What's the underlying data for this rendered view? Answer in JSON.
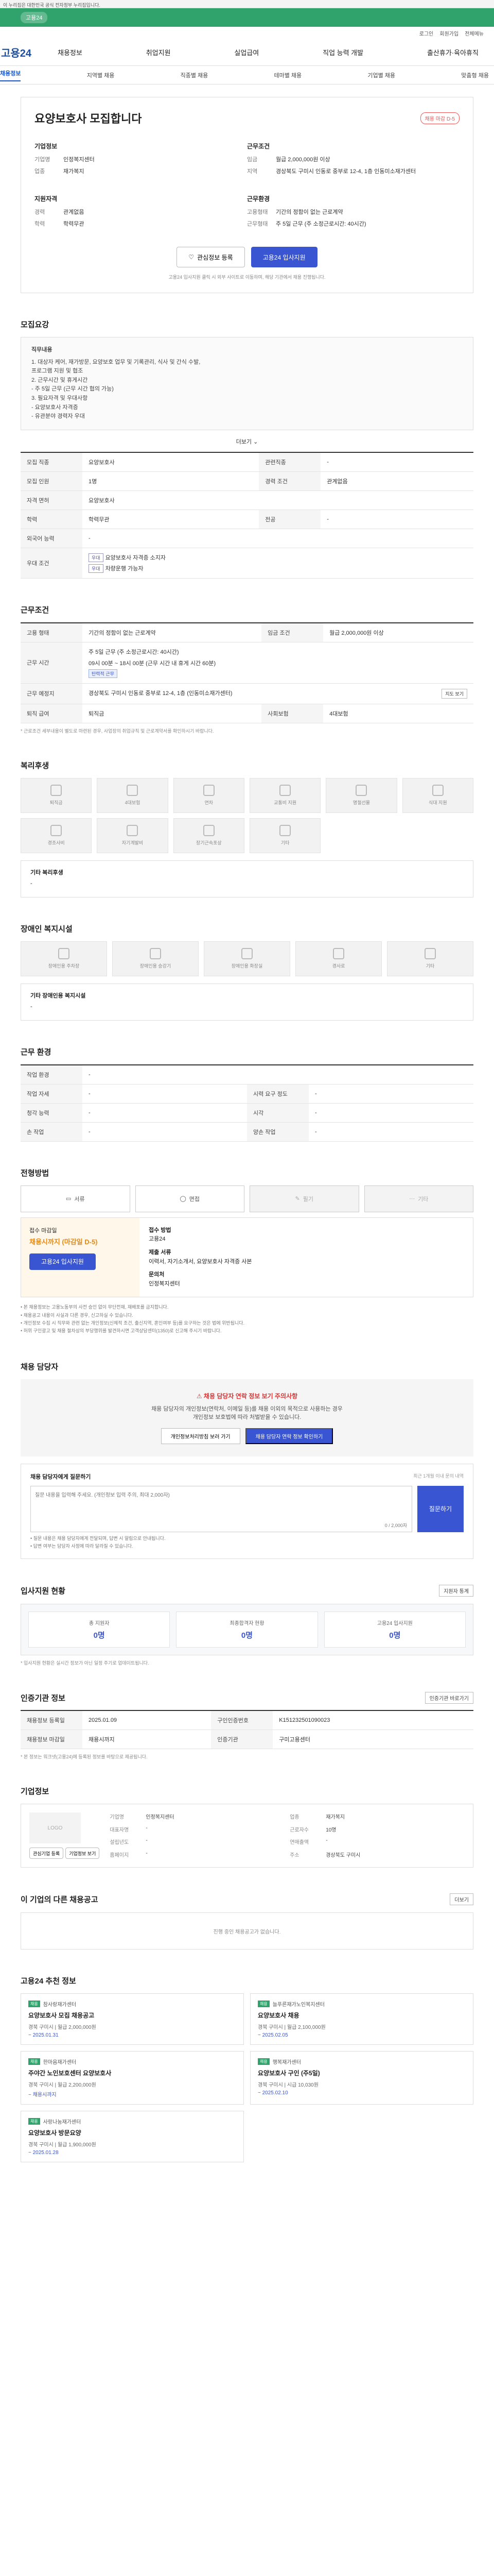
{
  "topbar": {
    "site": "이 누리집은 대한민국 공식 전자정부 누리집입니다.",
    "notice": ""
  },
  "greenbar": {
    "label": "고용24"
  },
  "util": [
    "로그인",
    "회원가입",
    "전체메뉴"
  ],
  "gnb": {
    "logo": "고용24",
    "menu": [
      "채용정보",
      "취업지원",
      "실업급여",
      "직업 능력 개발",
      "출산휴가·육아휴직"
    ]
  },
  "lnb": {
    "items": [
      "채용정보",
      "지역별 채용",
      "직종별 채용",
      "테마별 채용",
      "기업별 채용",
      "맞춤형 채용"
    ],
    "active_index": 0
  },
  "job": {
    "badge": "채용 마감 D-5",
    "title": "요양보호사 모집합니다",
    "company_h": "기업정보",
    "company_rows": [
      {
        "k": "기업명",
        "v": "인정복지센터"
      },
      {
        "k": "업종",
        "v": "재가복지"
      }
    ],
    "cond_h": "지원자격",
    "cond_rows": [
      {
        "k": "경력",
        "v": "관계없음"
      },
      {
        "k": "학력",
        "v": "학력무관"
      }
    ],
    "work_h": "근무조건",
    "work_rows": [
      {
        "k": "임금",
        "v": "월급 2,000,000원 이상"
      },
      {
        "k": "지역",
        "v": "경상북도 구미시 인동로 중부로 12-4, 1층 인동미소재가센터"
      }
    ],
    "area_h": "근무환경",
    "area_rows": [
      {
        "k": "고용형태",
        "v": "기간의 정함이 없는 근로계약"
      },
      {
        "k": "근무형태",
        "v": "주 5일 근무 (주 소정근로시간: 40시간)"
      }
    ],
    "extra_h": "채용정보",
    "extra_rows": [
      {
        "k": "",
        "v": ""
      }
    ],
    "btn_scrap": "관심정보 등록",
    "btn_apply": "고용24 입사지원",
    "small_note": "고용24 입사지원 클릭 시 외부 사이트로 이동하며, 해당 기관에서 채용 진행됩니다."
  },
  "recruit": {
    "title": "모집요강",
    "box_title": "직무내용",
    "box_lines": [
      "1. 대상자 케어, 재가방문, 요양보호 업무 및 기록관리, 식사 및 간식 수발,",
      "    프로그램 지원 및 협조",
      "2. 근무시간 및 휴게시간",
      "  - 주 5일 근무 (근무 시간 협의 가능)",
      "3. 필요자격 및 우대사항",
      "  - 요양보호사 자격증",
      "  - 유관분야 경력자 우대"
    ],
    "more": "더보기",
    "rows": [
      {
        "k": "모집 직종",
        "v": "요양보호사",
        "k2": "관련직종",
        "v2": "-"
      },
      {
        "k": "모집 인원",
        "v": "1명",
        "k2": "경력 조건",
        "v2": "관계없음"
      },
      {
        "k": "자격 면허",
        "v": "요양보호사",
        "k2": "",
        "v2": ""
      },
      {
        "k": "학력",
        "v": "학력무관",
        "k2": "전공",
        "v2": "-"
      },
      {
        "k": "외국어 능력",
        "v": "-",
        "k2": "",
        "v2": ""
      },
      {
        "k": "우대 조건",
        "v": "",
        "k2": "",
        "v2": ""
      }
    ],
    "tags": [
      "요양보호사 자격증 소지자",
      "차량운행 가능자"
    ]
  },
  "work": {
    "title": "근무조건",
    "rows": [
      {
        "k": "고용 형태",
        "v": "기간의 정함이 없는 근로계약",
        "k2": "임금 조건",
        "v2": "월급 2,000,000원 이상"
      },
      {
        "k": "근무 시간",
        "v": "주 5일 근무 (주 소정근로시간: 40시간)",
        "k2": "",
        "v2": ""
      },
      {
        "k": "근무 예정지",
        "v": "경상북도 구미시 인동로 중부로 12-4, 1층 (인동미소재가센터)",
        "k2": "",
        "v2": ""
      },
      {
        "k": "퇴직 급여",
        "v": "퇴직금",
        "k2": "사회보험",
        "v2": "4대보험"
      }
    ],
    "time_detail": "(오전 09:00 ~ 오후 06:00)",
    "time_tag": "탄력적 근무",
    "sched": "09시 00분 ~ 18시 00분 (근무 시간 내 휴게 시간 60분)",
    "view_btn": "지도 보기",
    "foot_note": "* 근로조건 세부내용이 별도로 마련된 경우, 사업장의 취업규칙 및 근로계약서를 확인하시기 바랍니다."
  },
  "welfare": {
    "title": "복리후생",
    "items": [
      "퇴직금",
      "4대보험",
      "연차",
      "교통비 지원",
      "명절선물",
      "식대 지원",
      "경조사비",
      "자기계발비",
      "장기근속포상",
      "기타"
    ],
    "extra_title": "기타 복리후생",
    "extra_value": "-"
  },
  "disability": {
    "title": "장애인 복지시설",
    "items": [
      "장애인용 주차장",
      "장애인용 승강기",
      "장애인용 화장실",
      "경사로",
      "기타"
    ],
    "extra_title": "기타 장애인용 복지시설",
    "extra_value": "-"
  },
  "env": {
    "title": "근무 환경",
    "rows": [
      {
        "k": "작업 환경",
        "v": "-",
        "k2": "",
        "v2": ""
      },
      {
        "k": "작업 자세",
        "v": "-",
        "k2": "시력 요구 정도",
        "v2": "-"
      },
      {
        "k": "청각 능력",
        "v": "-",
        "k2": "시각",
        "v2": "-"
      },
      {
        "k": "손 작업",
        "v": "-",
        "k2": "양손 작업",
        "v2": "-"
      }
    ]
  },
  "method": {
    "title": "전형방법",
    "steps": [
      "서류",
      "면접",
      "필기",
      "기타"
    ],
    "apply_h": "접수 마감일",
    "apply_date": "채용시까지 (마감일 D-5)",
    "apply_btn": "고용24 입사지원",
    "right_h1": "접수 방법",
    "right_v1": "고용24",
    "right_h2": "제출 서류",
    "right_v2": "이력서, 자기소개서, 요양보호사 자격증 사본",
    "right_h3": "문의처",
    "right_v3": "인정복지센터",
    "bullets": [
      "• 본 채용정보는 고용노동부의 사전 승인 없이 무단전재, 재배포를 금지합니다.",
      "• 채용공고 내용이 사실과 다른 경우, 신고하실 수 있습니다.",
      "• 개인정보 수집 시 직무와 관련 없는 개인정보(신체적 조건, 출신지역, 혼인여부 등)를 요구하는 것은 법에 위반됩니다.",
      "• 허위 구인광고 및 채용 절차상의 부당행위를 발견하시면 고객상담센터(1350)로 신고해 주시기 바랍니다."
    ]
  },
  "caution": {
    "title": "채용 담당자",
    "alert": "채용 담당자 연락 정보 보기 주의사항",
    "lines": [
      "채용 담당자의 개인정보(연락처, 이메일 등)를 채용 이외의 목적으로 사용하는 경우",
      "개인정보 보호법에 따라 처벌받을 수 있습니다."
    ],
    "b1": "개인정보처리방침 보러 가기",
    "b2": "채용 담당자 연락 정보 확인하기"
  },
  "inquiry": {
    "title": "채용 담당자에게 질문하기",
    "hint": "최근 1개월 이내 문의 내역",
    "placeholder": "질문 내용을 입력해 주세요. (개인정보 입력 주의, 최대 2,000자)",
    "submit": "질문하기",
    "counter": "0 / 2,000자",
    "notes": [
      "• 질문 내용은 채용 담당자에게 전달되며, 답변 시 알림으로 안내됩니다.",
      "• 답변 여부는 담당자 사정에 따라 달라질 수 있습니다."
    ]
  },
  "stats": {
    "title": "입사지원 현황",
    "more": "지원자 통계",
    "items": [
      {
        "k": "총 지원자",
        "v": "0명"
      },
      {
        "k": "최종합격자 현황",
        "v": "0명"
      },
      {
        "k": "고용24 입사지원",
        "v": "0명"
      }
    ],
    "note": "* 입사지원 현황은 실시간 정보가 아닌 일정 주기로 업데이트됩니다."
  },
  "manage": {
    "title": "인증기관 정보",
    "right": "인증기관 바로가기",
    "rows": [
      {
        "k": "채용정보 등록일",
        "v": "2025.01.09",
        "k2": "구인인증번호",
        "v2": "K151232501090023"
      },
      {
        "k": "채용정보 마감일",
        "v": "채용시까지",
        "k2": "인증기관",
        "v2": "구미고용센터"
      }
    ],
    "note": "* 본 정보는 워크넷(고용24)에 등록된 정보를 바탕으로 제공됩니다."
  },
  "company": {
    "title": "기업정보",
    "logo": "LOGO",
    "btn1": "관심기업 등록",
    "btn2": "기업정보 보기",
    "rows": [
      {
        "k": "기업명",
        "v": "인정복지센터"
      },
      {
        "k": "업종",
        "v": "재가복지"
      },
      {
        "k": "대표자명",
        "v": "-"
      },
      {
        "k": "근로자수",
        "v": "10명"
      },
      {
        "k": "설립년도",
        "v": "-"
      },
      {
        "k": "연매출액",
        "v": "-"
      },
      {
        "k": "홈페이지",
        "v": "-"
      },
      {
        "k": "주소",
        "v": "경상북도 구미시"
      }
    ]
  },
  "others": {
    "title": "이 기업의 다른 채용공고",
    "more": "더보기",
    "empty": "진행 중인 채용공고가 없습니다."
  },
  "recommend": {
    "title": "고용24 추천 정보",
    "cards": [
      {
        "tag": "채용",
        "org": "참사랑재가센터",
        "title": "요양보호사 모집 채용공고",
        "meta": "경북 구미시  |  월급 2,000,000원",
        "date": "~ 2025.01.31"
      },
      {
        "tag": "채용",
        "org": "늘푸른재가노인복지센터",
        "title": "요양보호사 채용",
        "meta": "경북 구미시  |  월급 2,100,000원",
        "date": "~ 2025.02.05"
      },
      {
        "tag": "채용",
        "org": "한마음재가센터",
        "title": "주야간 노인보호센터 요양보호사",
        "meta": "경북 구미시  |  월급 2,200,000원",
        "date": "~ 채용시까지"
      },
      {
        "tag": "채용",
        "org": "행복재가센터",
        "title": "요양보호사 구인 (주5일)",
        "meta": "경북 구미시  |  시급 10,030원",
        "date": "~ 2025.02.10"
      },
      {
        "tag": "채용",
        "org": "사랑나눔재가센터",
        "title": "요양보호사 방문요양",
        "meta": "경북 구미시  |  월급 1,900,000원",
        "date": "~ 2025.01.28"
      }
    ]
  }
}
